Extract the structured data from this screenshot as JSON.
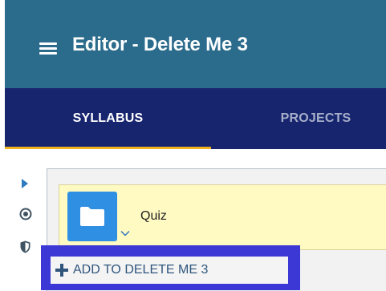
{
  "app_bar": {
    "title": "Editor - Delete Me 3",
    "menu_icon": "hamburger-menu-icon"
  },
  "tabs": [
    {
      "label": "SYLLABUS",
      "active": true
    },
    {
      "label": "PROJECTS",
      "active": false
    }
  ],
  "side_icons": [
    "caret-right-icon",
    "target-icon",
    "shield-icon"
  ],
  "node": {
    "label": "Quiz",
    "icon": "folder-icon",
    "expand_icon": "chevron-down-icon"
  },
  "add_button": {
    "label": "ADD TO DELETE ME 3",
    "icon": "plus-icon"
  },
  "colors": {
    "app_bar": "#2b6b8c",
    "tab_bar": "#17256f",
    "tab_indicator": "#f0b31f",
    "node_card": "#fff9c2",
    "folder_tile": "#2f8fe3",
    "highlight": "#3c38d6",
    "add_text": "#2f557d"
  }
}
